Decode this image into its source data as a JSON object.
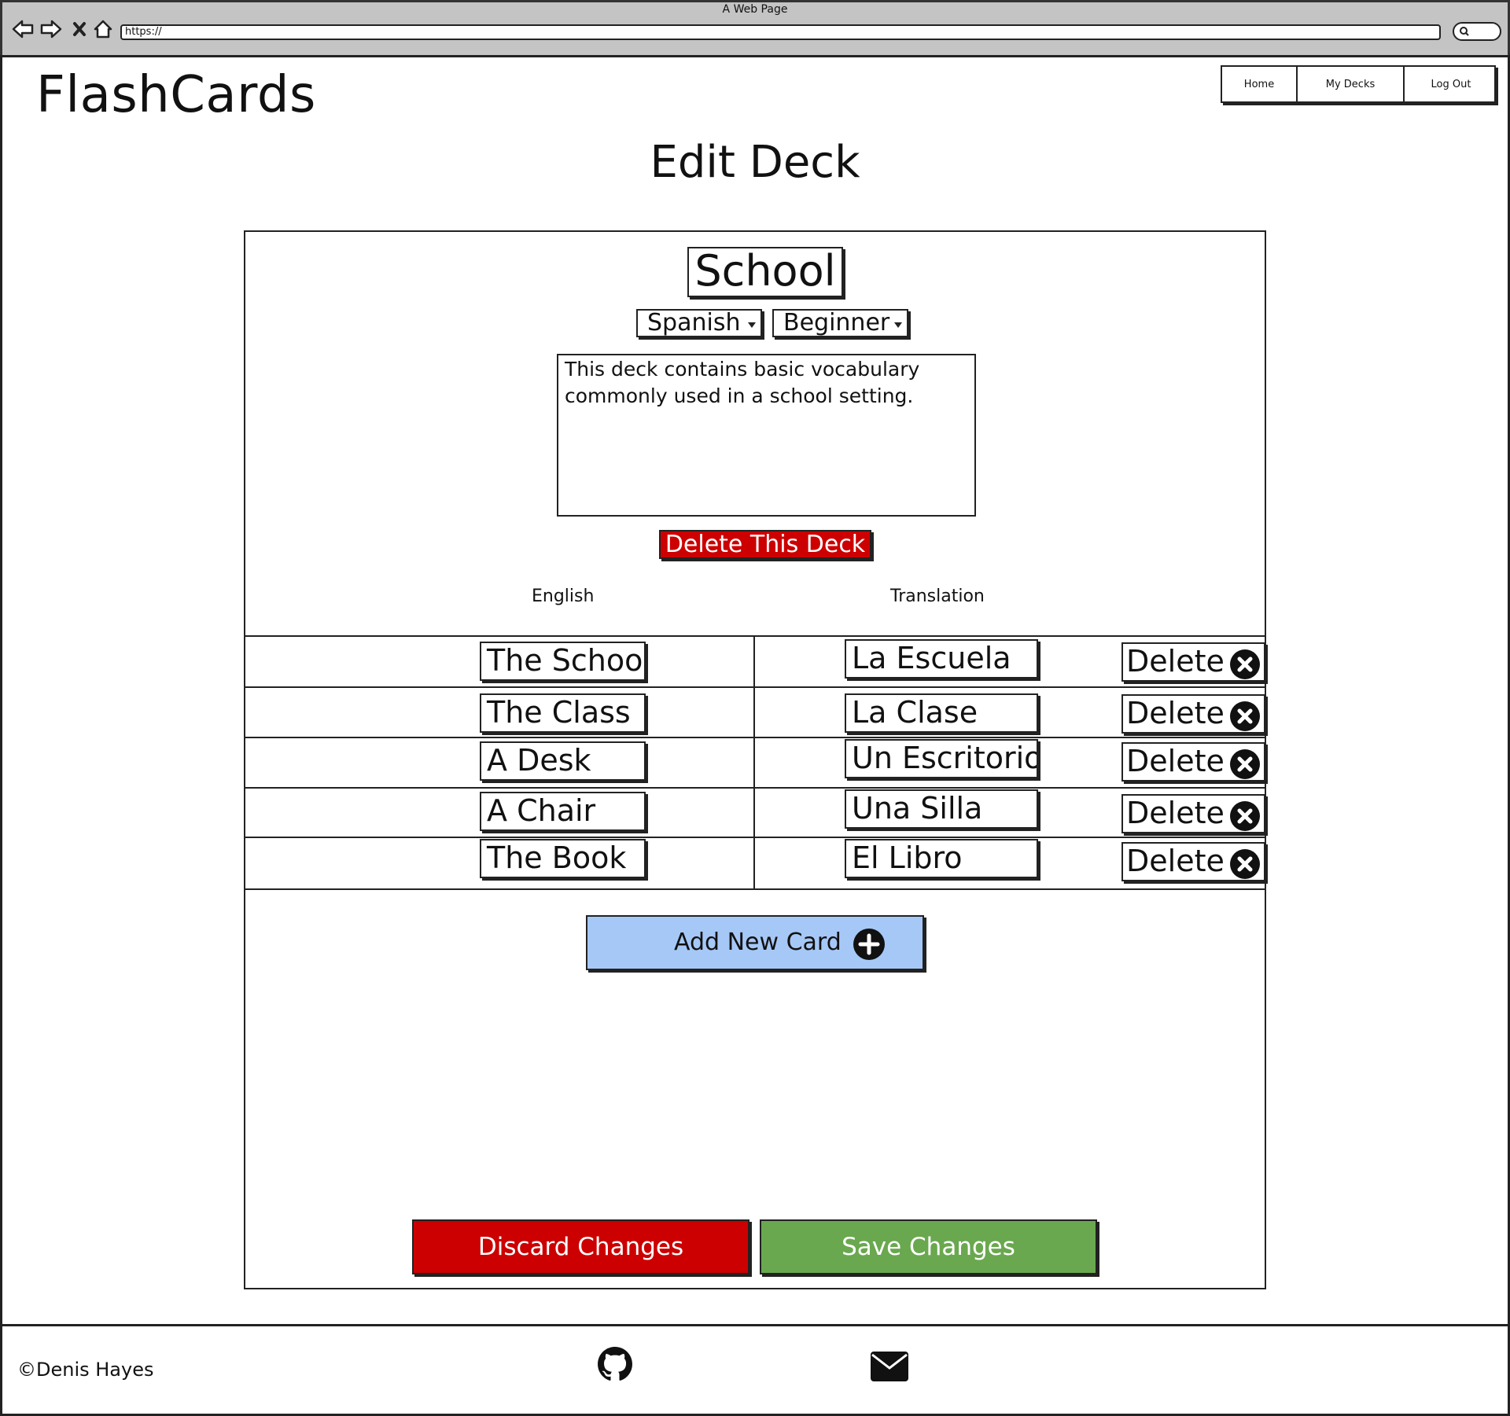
{
  "browser": {
    "title": "A Web Page",
    "url": "https://",
    "nav_icons": [
      "back-arrow-icon",
      "forward-arrow-icon",
      "close-x-icon",
      "home-icon"
    ]
  },
  "app": {
    "brand": "FlashCards"
  },
  "nav": {
    "items": [
      "Home",
      "My Decks",
      "Log Out"
    ]
  },
  "page": {
    "title": "Edit Deck"
  },
  "deck": {
    "name": "School",
    "language": "Spanish",
    "level": "Beginner",
    "description": "This deck contains basic vocabulary\ncommonly used in a school setting.",
    "delete_label": "Delete This Deck"
  },
  "table": {
    "headers": {
      "english": "English",
      "translation": "Translation"
    },
    "delete_label": "Delete",
    "rows": [
      {
        "english": "The School",
        "translation": "La Escuela"
      },
      {
        "english": "The Class",
        "translation": "La Clase"
      },
      {
        "english": "A Desk",
        "translation": "Un Escritorio"
      },
      {
        "english": "A Chair",
        "translation": "Una Silla"
      },
      {
        "english": "The Book",
        "translation": "El Libro"
      }
    ]
  },
  "actions": {
    "add_card": "Add New Card",
    "discard": "Discard Changes",
    "save": "Save Changes"
  },
  "footer": {
    "copyright": "©Denis Hayes",
    "icons": [
      "github-icon",
      "mail-icon"
    ]
  },
  "colors": {
    "danger": "#cc0000",
    "success": "#6aa84f",
    "add_button": "#a6c8f7",
    "chrome": "#c4c4c4"
  }
}
